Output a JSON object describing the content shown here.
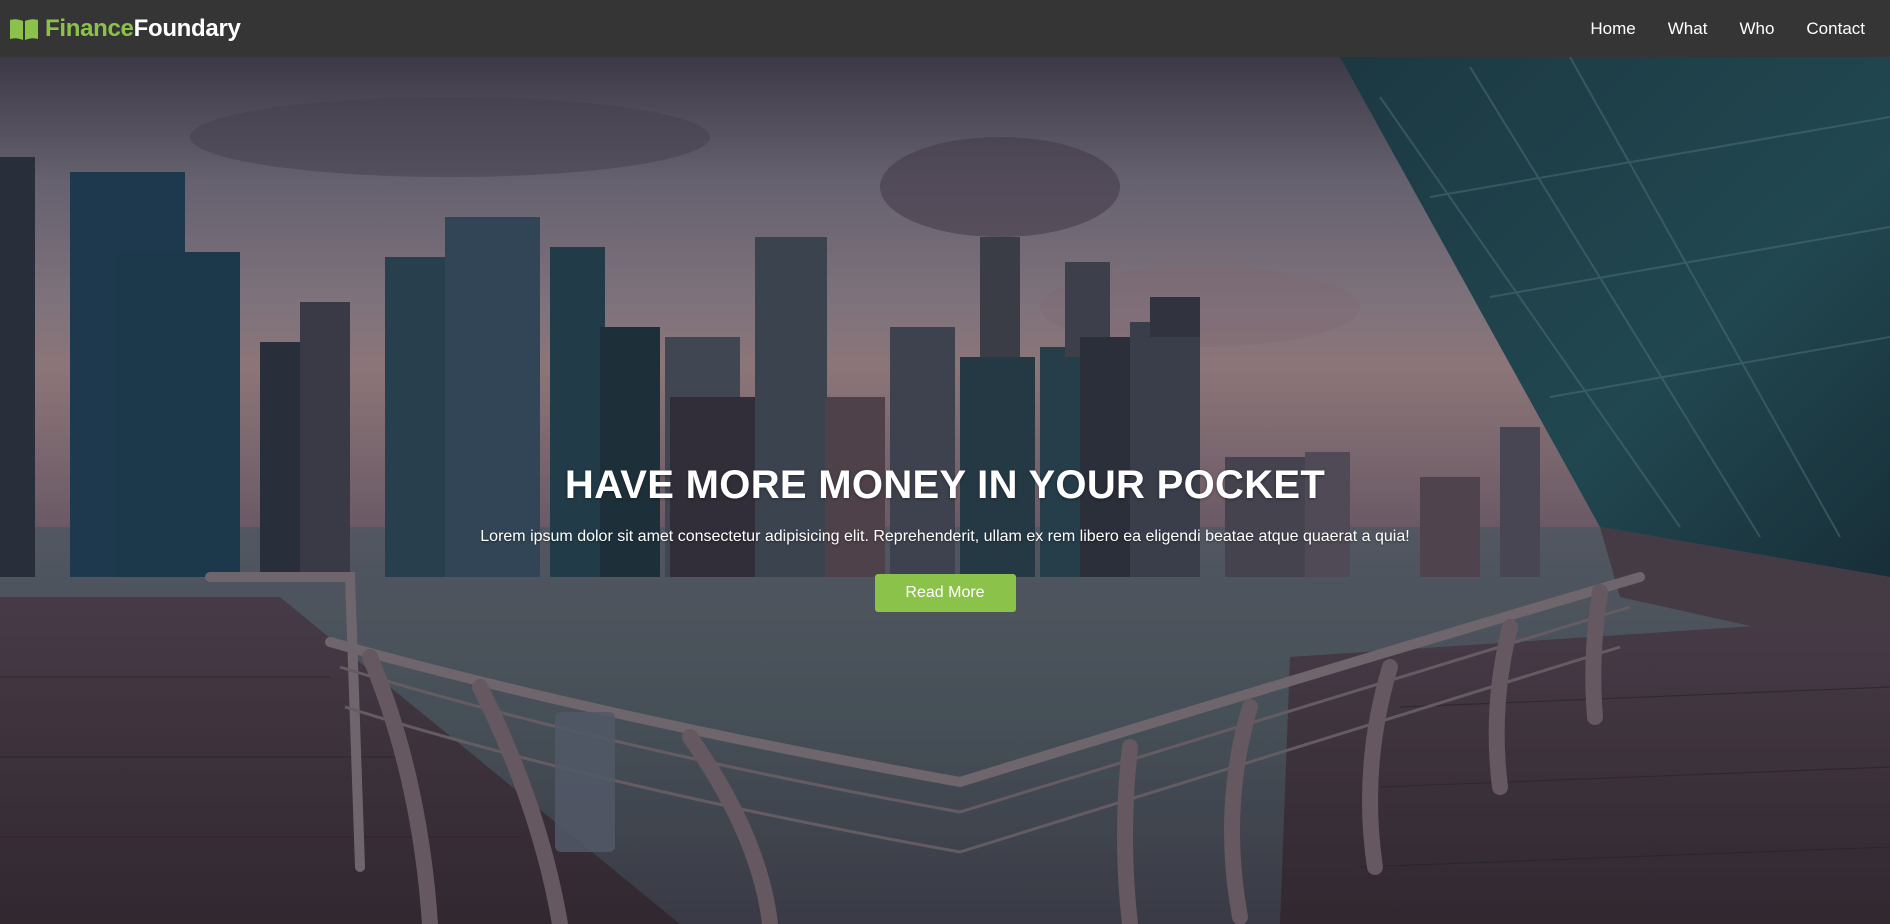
{
  "brand": {
    "icon": "open-book-icon",
    "name_part1": "Finance",
    "name_part2": "Foundary"
  },
  "nav": {
    "items": [
      {
        "label": "Home"
      },
      {
        "label": "What"
      },
      {
        "label": "Who"
      },
      {
        "label": "Contact"
      }
    ]
  },
  "hero": {
    "title": "HAVE MORE MONEY IN YOUR POCKET",
    "subtitle": "Lorem ipsum dolor sit amet consectetur adipisicing elit. Reprehenderit, ullam ex rem libero ea eligendi beatae atque quaerat a quia!",
    "button_label": "Read More",
    "background": "city-skyline-waterfront-photo"
  },
  "colors": {
    "navbar_bg": "#353535",
    "accent": "#8bc34a",
    "text": "#ffffff"
  }
}
